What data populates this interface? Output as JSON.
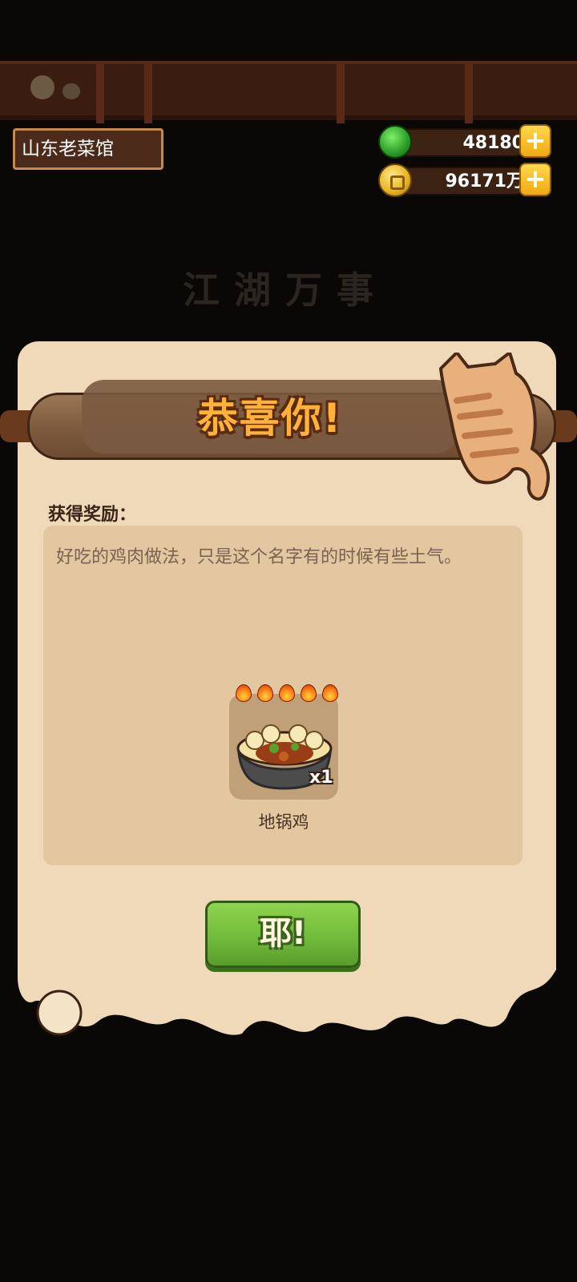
{
  "header": {
    "shop_name": "山东老菜馆"
  },
  "currency": {
    "gems": "48180",
    "coins": "96171万",
    "gem_icon": "green-gem-icon",
    "coin_icon": "gold-coin-icon",
    "add_icon": "plus-icon"
  },
  "background": {
    "panel_title": "江湖万事"
  },
  "dialog": {
    "title": "恭喜你!",
    "reward_label": "获得奖励：",
    "description": "好吃的鸡肉做法，只是这个名字有的时候有些土气。",
    "item": {
      "name": "地锅鸡",
      "quantity": "x1",
      "stars": 5,
      "icon": "dish-icon"
    },
    "confirm_label": "耶!"
  },
  "colors": {
    "parchment": "#efd9b9",
    "button_green": "#6fb83a",
    "title_orange": "#ffb13b"
  }
}
